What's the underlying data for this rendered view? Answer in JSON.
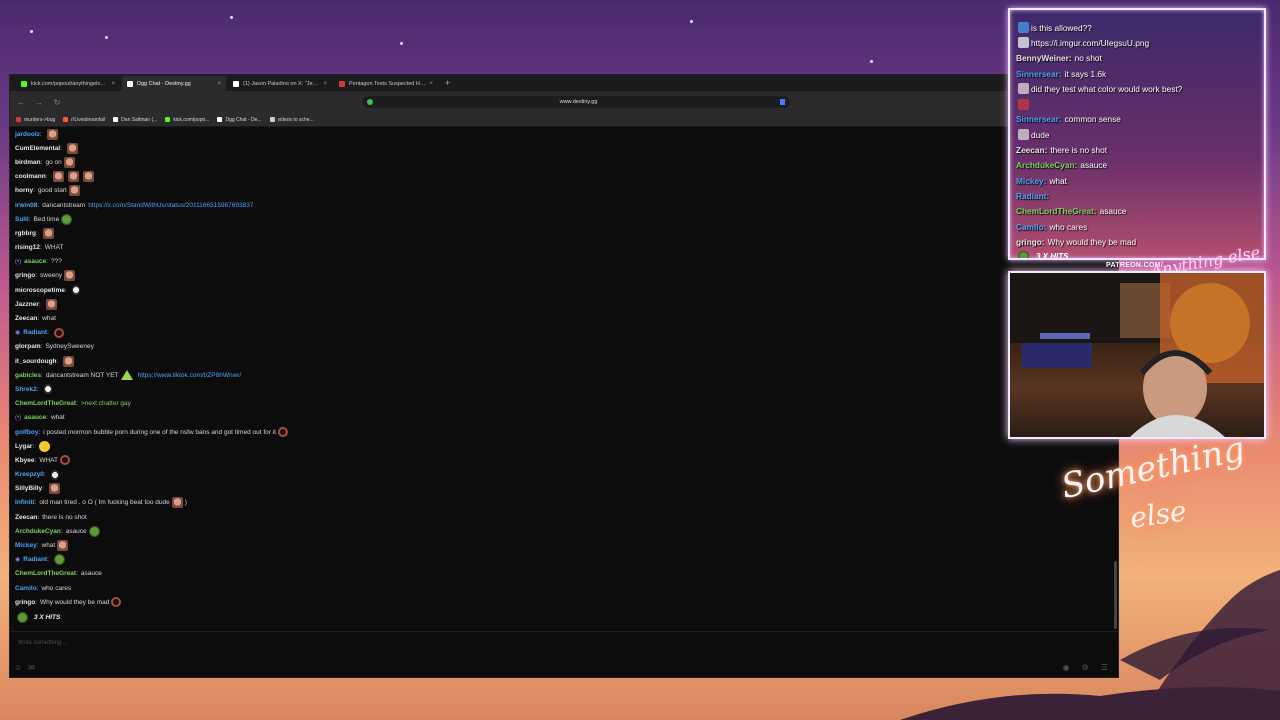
{
  "browser": {
    "tabs": [
      {
        "label": "kick.com/popout/anythingelse/chat",
        "icon": "kick-icon",
        "color": "#53fc18"
      },
      {
        "label": "Dgg Chat - Destiny.gg",
        "icon": "destiny-icon",
        "color": "#ffffff",
        "active": true
      },
      {
        "label": "(1) Jason Paladino on X: \"Jesus fu",
        "icon": "x-icon",
        "color": "#ffffff"
      },
      {
        "label": "Pentagon Tests Suspected Havana",
        "icon": "news-icon",
        "color": "#d23a3a"
      }
    ],
    "url": "www.destiny.gg",
    "bookmarks": [
      {
        "label": "murders->bug",
        "color": "#d23a3a"
      },
      {
        "label": "r/Livestreamfail",
        "color": "#ff5a2a"
      },
      {
        "label": "Dan Saltman (...",
        "color": "#ffffff"
      },
      {
        "label": "kick.com/popo...",
        "color": "#53fc18"
      },
      {
        "label": "Dgg Chat - De...",
        "color": "#ffffff"
      },
      {
        "label": "videos to sche...",
        "color": "#cccccc"
      }
    ]
  },
  "chat": {
    "messages": [
      {
        "user": "jardoolz",
        "color": "#4aa3f5",
        "text": "",
        "emotes": [
          "face"
        ]
      },
      {
        "user": "CumElemental",
        "color": "#e6e6e6",
        "text": "",
        "emotes": [
          "face"
        ]
      },
      {
        "user": "birdman",
        "color": "#e6e6e6",
        "text": "go on",
        "emotes": [
          "face"
        ]
      },
      {
        "user": "coolmann",
        "color": "#e6e6e6",
        "text": "",
        "emotes": [
          "face",
          "face",
          "face"
        ]
      },
      {
        "user": "horny",
        "color": "#e6e6e6",
        "text": "good start",
        "emotes": [
          "face"
        ]
      },
      {
        "user": "irwin08",
        "color": "#4aa3f5",
        "text": "dancantstream",
        "link": "https://x.com/StandWithUs/status/2011166515987693837"
      },
      {
        "user": "Sulli",
        "color": "#4aa3f5",
        "text": "Bed time",
        "emotes": [
          "pepe"
        ]
      },
      {
        "user": "rgbbrg",
        "color": "#e6e6e6",
        "text": "",
        "emotes": [
          "face"
        ]
      },
      {
        "user": "rising12",
        "color": "#e6e6e6",
        "text": "WHAT"
      },
      {
        "user": "asauce",
        "color": "#7dd060",
        "text": "???",
        "flair": "(•)"
      },
      {
        "user": "gringo",
        "color": "#e6e6e6",
        "text": "sweeny",
        "emotes": [
          "face"
        ]
      },
      {
        "user": "microscopetime",
        "color": "#e6e6e6",
        "text": "",
        "emotes": [
          "skull"
        ]
      },
      {
        "user": "Jazzner",
        "color": "#e6e6e6",
        "text": "",
        "emotes": [
          "face"
        ]
      },
      {
        "user": "Zeecan",
        "color": "#e6e6e6",
        "text": "what"
      },
      {
        "user": "Radiant",
        "color": "#4aa3f5",
        "text": "",
        "emotes": [
          "ring"
        ],
        "flair": "◉"
      },
      {
        "user": "glorpam",
        "color": "#e6e6e6",
        "text": "SydneySweeney"
      },
      {
        "user": "it_sourdough",
        "color": "#e6e6e6",
        "text": "",
        "emotes": [
          "face"
        ]
      },
      {
        "user": "gabicles",
        "color": "#7dd060",
        "text": "dancantstream NOT YET",
        "emotes": [
          "pyr"
        ],
        "link": "https://www.tiktok.com/t/ZP8hWnwr/"
      },
      {
        "user": "Shrek2",
        "color": "#4aa3f5",
        "text": "",
        "emotes": [
          "skull"
        ]
      },
      {
        "user": "ChemLordTheGreat",
        "color": "#7dd060",
        "text": ">next chatter gay",
        "greentext": true
      },
      {
        "user": "asauce",
        "color": "#7dd060",
        "text": "what",
        "flair": "(•)"
      },
      {
        "user": "golfboy",
        "color": "#4aa3f5",
        "text": "i posted mormon bubble porn during one of the nsfw bans and got timed out for it",
        "emotes": [
          "ring"
        ]
      },
      {
        "user": "Lygar",
        "color": "#e6e6e6",
        "text": "",
        "emotes": [
          "blob"
        ]
      },
      {
        "user": "Kbyee",
        "color": "#e6e6e6",
        "text": "WHAT",
        "emotes": [
          "ring"
        ]
      },
      {
        "user": "Kreepzy0",
        "color": "#4aa3f5",
        "text": "",
        "emotes": [
          "skull"
        ]
      },
      {
        "user": "SillyBilly",
        "color": "#e6e6e6",
        "text": "",
        "emotes": [
          "face"
        ]
      },
      {
        "user": "Infiniti",
        "color": "#4aa3f5",
        "text": "old man tired . o O ( Im fucking beat too dude",
        "emotes": [
          "face"
        ],
        "suffix": ")"
      },
      {
        "user": "Zeecan",
        "color": "#e6e6e6",
        "text": "there is no shot"
      },
      {
        "user": "ArchdukeCyan",
        "color": "#7dd060",
        "text": "asauce",
        "emotes": [
          "pepe"
        ]
      },
      {
        "user": "Mickey",
        "color": "#4aa3f5",
        "text": "what",
        "emotes": [
          "face"
        ]
      },
      {
        "user": "Radiant",
        "color": "#4aa3f5",
        "text": "",
        "emotes": [
          "pepe"
        ],
        "flair": "◉"
      },
      {
        "user": "ChemLordTheGreat",
        "color": "#7dd060",
        "text": "asauce"
      },
      {
        "user": "Camilo",
        "color": "#4aa3f5",
        "text": "who cares"
      },
      {
        "user": "gringo",
        "color": "#e6e6e6",
        "text": "Why would they be mad",
        "emotes": [
          "ring"
        ]
      }
    ],
    "combo": "3 X HITS",
    "input_placeholder": "Write something ..."
  },
  "overlay": {
    "messages": [
      {
        "user": "",
        "color": "#4aa3f5",
        "text": "is this allowed??"
      },
      {
        "user": "",
        "color": "#ffffff",
        "text": "https://i.imgur.com/UIegsuU.png"
      },
      {
        "user": "BennyWeiner:",
        "color": "#e6e6e6",
        "text": "no shot"
      },
      {
        "user": "Sinnersear:",
        "color": "#4aa3f5",
        "text": "it says 1.6k"
      },
      {
        "user": "",
        "color": "#e6e6e6",
        "text": "did they test what color would work best?"
      },
      {
        "user": "",
        "color": "#d23a3a",
        "text": ""
      },
      {
        "user": "Sinnersear:",
        "color": "#4aa3f5",
        "text": "common sense"
      },
      {
        "user": "",
        "color": "#e6e6e6",
        "text": "dude"
      },
      {
        "user": "Zeecan:",
        "color": "#e6e6e6",
        "text": "there is no shot"
      },
      {
        "user": "ArchdukeCyan:",
        "color": "#7dd060",
        "text": "asauce"
      },
      {
        "user": "Mickey:",
        "color": "#4aa3f5",
        "text": "what"
      },
      {
        "user": "Radiant:",
        "color": "#4aa3f5",
        "text": ""
      },
      {
        "user": "ChemLordTheGreat:",
        "color": "#7dd060",
        "text": "asauce"
      },
      {
        "user": "Camilo:",
        "color": "#4aa3f5",
        "text": "who cares"
      },
      {
        "user": "gringo:",
        "color": "#e6e6e6",
        "text": "Why would they be mad"
      }
    ],
    "combo": "3 X HITS",
    "patreon": "PATREON.COM/",
    "brand_logo_text": "Anything else",
    "neon_line1": "Something",
    "neon_line2": "else"
  }
}
